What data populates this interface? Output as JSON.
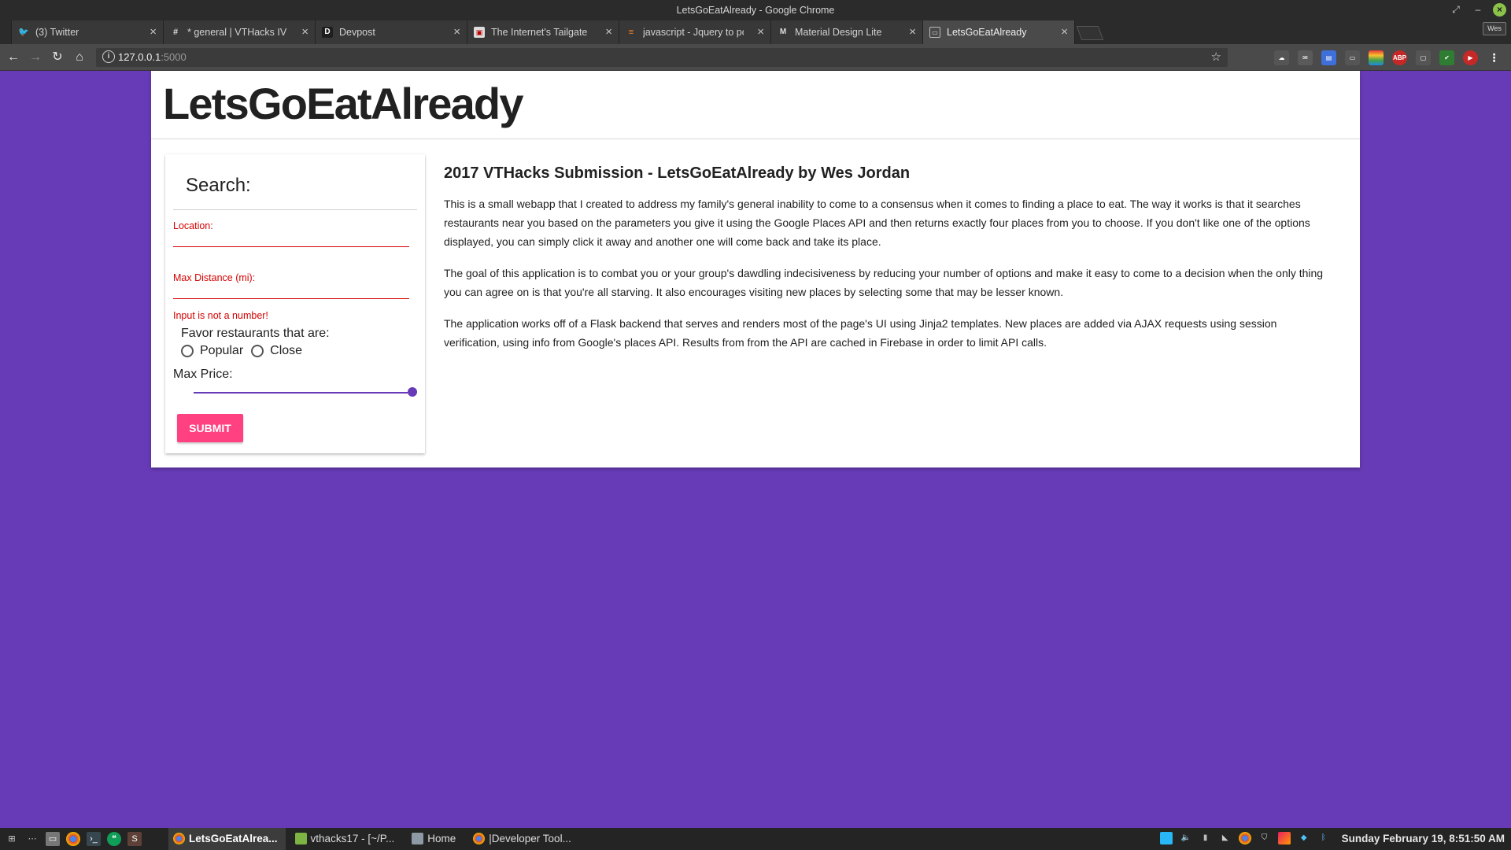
{
  "window": {
    "title": "LetsGoEatAlready - Google Chrome",
    "profile": "Wes"
  },
  "tabs": [
    {
      "label": "(3) Twitter",
      "icon": "twitter-icon",
      "active": false
    },
    {
      "label": "* general | VTHacks IV S",
      "icon": "slack-hash-icon",
      "active": false
    },
    {
      "label": "Devpost",
      "icon": "devpost-icon",
      "active": false
    },
    {
      "label": "The Internet's Tailgate",
      "icon": "tailgate-icon",
      "active": false
    },
    {
      "label": "javascript - Jquery to po",
      "icon": "stackoverflow-icon",
      "active": false
    },
    {
      "label": "Material Design Lite",
      "icon": "mdl-icon",
      "active": false
    },
    {
      "label": "LetsGoEatAlready",
      "icon": "page-icon",
      "active": true
    }
  ],
  "toolbar": {
    "url_host": "127.0.0.1",
    "url_port": ":5000"
  },
  "page": {
    "site_title": "LetsGoEatAlready",
    "search": {
      "title": "Search:",
      "location_label": "Location:",
      "location_value": "",
      "distance_label": "Max Distance (mi):",
      "distance_value": "",
      "distance_error": "Input is not a number!",
      "favor_label": "Favor restaurants that are:",
      "option_popular": "Popular",
      "option_close": "Close",
      "price_label": "Max Price:",
      "price_fraction": 1.0,
      "submit_label": "SUBMIT"
    },
    "content": {
      "heading": "2017 VTHacks Submission - LetsGoEatAlready by Wes Jordan",
      "p1": "This is a small webapp that I created to address my family's general inability to come to a consensus when it comes to finding a place to eat. The way it works is that it searches restaurants near you based on the parameters you give it using the Google Places API and then returns exactly four places from you to choose. If you don't like one of the options displayed, you can simply click it away and another one will come back and take its place.",
      "p2": "The goal of this application is to combat you or your group's dawdling indecisiveness by reducing your number of options and make it easy to come to a decision when the only thing you can agree on is that you're all starving. It also encourages visiting new places by selecting some that may be lesser known.",
      "p3": "The application works off of a Flask backend that serves and renders most of the page's UI using Jinja2 templates. New places are added via AJAX requests using session verification, using info from Google's places API. Results from from the API are cached in Firebase in order to limit API calls."
    }
  },
  "taskbar": {
    "tasks": [
      {
        "label": "LetsGoEatAlrea...",
        "active": true
      },
      {
        "label": "vthacks17 - [~/P...",
        "active": false
      },
      {
        "label": "Home",
        "active": false
      },
      {
        "label": "|Developer Tool...",
        "active": false
      }
    ],
    "clock": "Sunday February 19,  8:51:50 AM"
  },
  "colors": {
    "background": "#673ab7",
    "accent": "#ff4081",
    "error": "#d50000"
  }
}
